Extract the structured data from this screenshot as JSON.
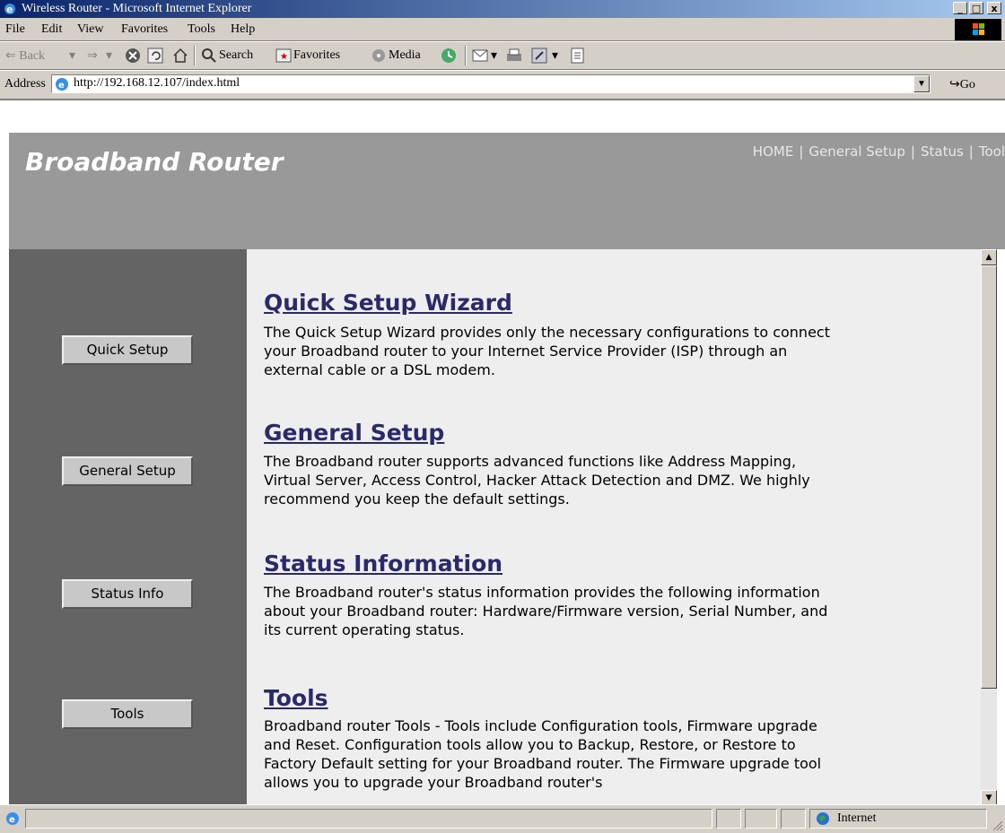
{
  "window": {
    "title": "Wireless Router - Microsoft Internet Explorer",
    "buttons": {
      "minimize": "_",
      "maximize": "□",
      "close": "x"
    }
  },
  "menu": [
    "File",
    "Edit",
    "View",
    "Favorites",
    "Tools",
    "Help"
  ],
  "toolbar": {
    "back": "⇐ Back",
    "forward": "⇒",
    "search": "Search",
    "favorites": "Favorites",
    "media": "Media"
  },
  "address": {
    "label": "Address",
    "url": "http://192.168.12.107/index.html",
    "go": "Go"
  },
  "page": {
    "banner_title": "Broadband Router",
    "top_nav": [
      "HOME",
      "General Setup",
      "Status",
      "Tool"
    ],
    "sidebar_buttons": [
      "Quick Setup",
      "General Setup",
      "Status Info",
      "Tools"
    ],
    "sections": [
      {
        "heading": "Quick Setup Wizard",
        "text": "The Quick Setup Wizard provides only the necessary configurations to connect your Broadband router to your Internet Service Provider (ISP) through an external cable or a DSL modem."
      },
      {
        "heading": "General Setup",
        "text": "The Broadband router supports advanced functions like Address Mapping, Virtual Server, Access Control, Hacker Attack Detection and DMZ. We highly recommend you keep the default settings."
      },
      {
        "heading": "Status Information",
        "text": "The Broadband router's status information provides the following information about your Broadband router: Hardware/Firmware version, Serial Number, and its current operating status."
      },
      {
        "heading": "Tools",
        "text": "Broadband router Tools - Tools include Configuration tools, Firmware upgrade and Reset. Configuration tools allow you to Backup, Restore, or Restore to Factory Default setting for your Broadband router. The Firmware upgrade tool allows you to upgrade your Broadband router's"
      }
    ]
  },
  "status": {
    "zone": "Internet"
  },
  "colors": {
    "banner": "#999999",
    "sidebar": "#636463",
    "main_bg": "#eeeeee",
    "heading": "#2a2a6a"
  }
}
